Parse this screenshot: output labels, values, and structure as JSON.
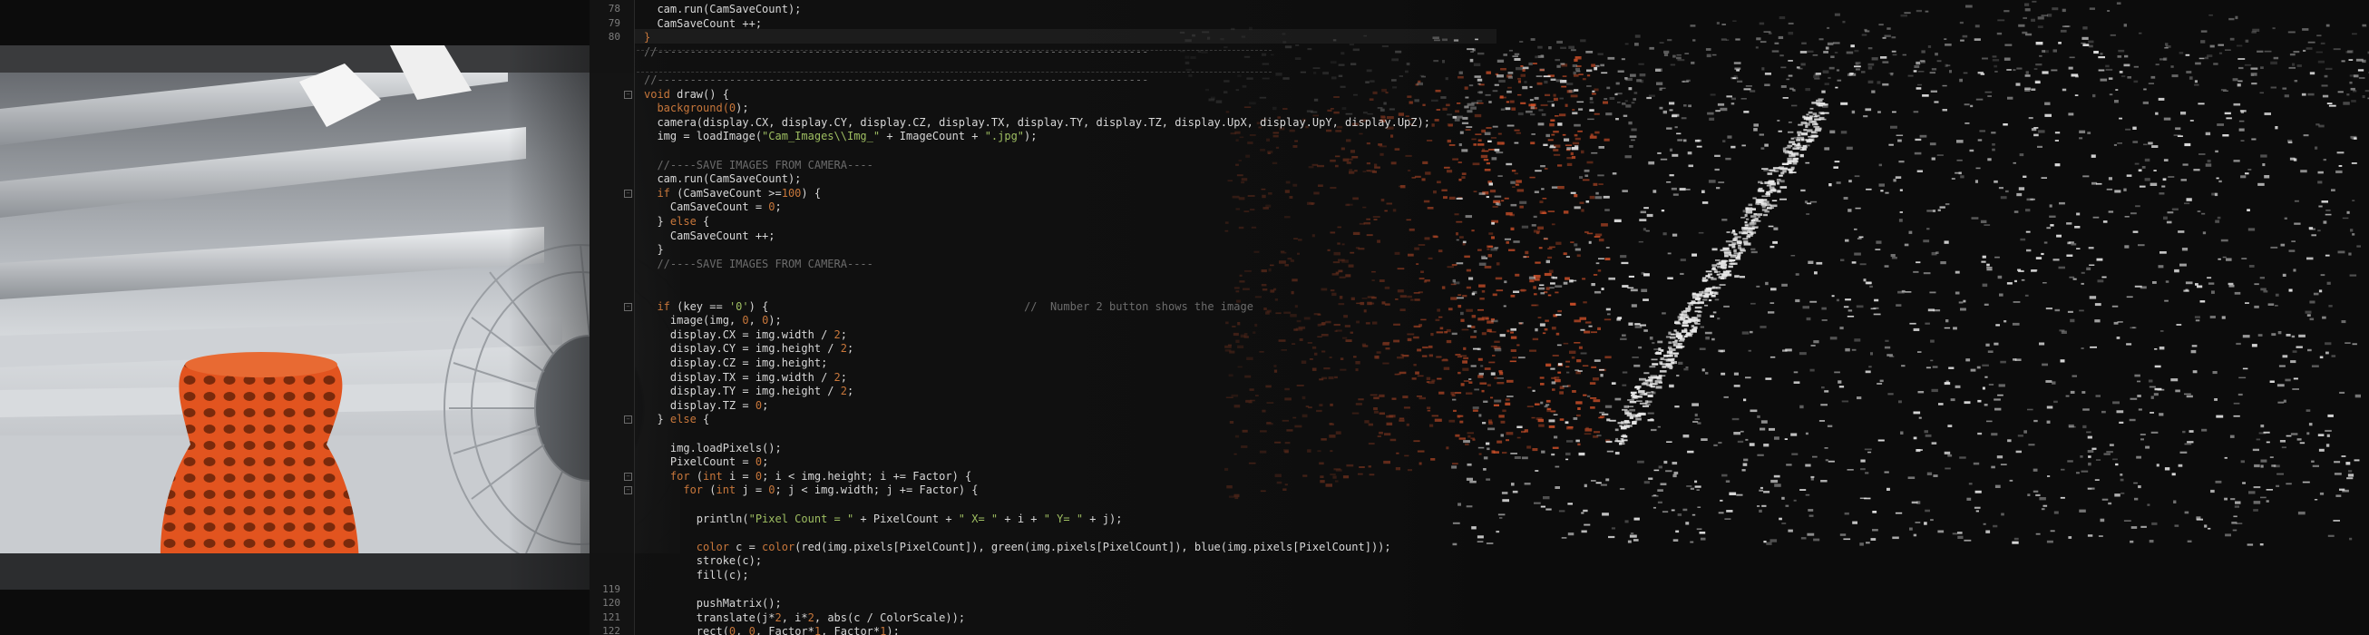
{
  "editor": {
    "lines": [
      {
        "n": "78",
        "segments": [
          {
            "t": "  cam.run(CamSaveCount);",
            "c": "plain"
          }
        ]
      },
      {
        "n": "79",
        "segments": [
          {
            "t": "  CamSaveCount ++;",
            "c": "plain"
          }
        ]
      },
      {
        "n": "80",
        "segments": [
          {
            "t": "}",
            "c": "kw"
          }
        ]
      },
      {
        "n": "",
        "segments": [
          {
            "t": "//---------------------------------------------------------------------------",
            "c": "cmt"
          }
        ]
      },
      {
        "n": "",
        "segments": [
          {
            "t": "",
            "c": "plain"
          }
        ]
      },
      {
        "n": "",
        "segments": [
          {
            "t": "//---------------------------------------------------------------------------",
            "c": "cmt"
          }
        ]
      },
      {
        "n": "",
        "segments": [
          {
            "t": "void",
            "c": "kw"
          },
          {
            "t": " draw() {",
            "c": "plain"
          }
        ]
      },
      {
        "n": "",
        "segments": [
          {
            "t": "  background(",
            "c": "kw"
          },
          {
            "t": "0",
            "c": "num"
          },
          {
            "t": ");",
            "c": "plain"
          }
        ]
      },
      {
        "n": "",
        "segments": [
          {
            "t": "  camera(display.CX, display.CY, display.CZ, display.TX, display.TY, display.TZ, display.UpX, display.UpY, display.UpZ);",
            "c": "plain"
          }
        ]
      },
      {
        "n": "",
        "segments": [
          {
            "t": "  img = loadImage(",
            "c": "plain"
          },
          {
            "t": "\"Cam_Images\\\\Img_\"",
            "c": "str"
          },
          {
            "t": " + ImageCount + ",
            "c": "plain"
          },
          {
            "t": "\".jpg\"",
            "c": "str"
          },
          {
            "t": ");",
            "c": "plain"
          }
        ]
      },
      {
        "n": "",
        "segments": [
          {
            "t": "",
            "c": "plain"
          }
        ]
      },
      {
        "n": "",
        "segments": [
          {
            "t": "  //----SAVE IMAGES FROM CAMERA----",
            "c": "cmt"
          }
        ]
      },
      {
        "n": "",
        "segments": [
          {
            "t": "  cam.run(CamSaveCount);",
            "c": "plain"
          }
        ]
      },
      {
        "n": "",
        "segments": [
          {
            "t": "  if",
            "c": "kw"
          },
          {
            "t": " (CamSaveCount >=",
            "c": "plain"
          },
          {
            "t": "100",
            "c": "num"
          },
          {
            "t": ") {",
            "c": "plain"
          }
        ]
      },
      {
        "n": "",
        "segments": [
          {
            "t": "    CamSaveCount = ",
            "c": "plain"
          },
          {
            "t": "0",
            "c": "num"
          },
          {
            "t": ";",
            "c": "plain"
          }
        ]
      },
      {
        "n": "",
        "segments": [
          {
            "t": "  } ",
            "c": "plain"
          },
          {
            "t": "else",
            "c": "kw"
          },
          {
            "t": " {",
            "c": "plain"
          }
        ]
      },
      {
        "n": "",
        "segments": [
          {
            "t": "    CamSaveCount ++;",
            "c": "plain"
          }
        ]
      },
      {
        "n": "",
        "segments": [
          {
            "t": "  }",
            "c": "plain"
          }
        ]
      },
      {
        "n": "",
        "segments": [
          {
            "t": "  //----SAVE IMAGES FROM CAMERA----",
            "c": "cmt"
          }
        ]
      },
      {
        "n": "",
        "segments": [
          {
            "t": "",
            "c": "plain"
          }
        ]
      },
      {
        "n": "",
        "segments": [
          {
            "t": "",
            "c": "plain"
          }
        ]
      },
      {
        "n": "",
        "segments": [
          {
            "t": "  if",
            "c": "kw"
          },
          {
            "t": " (key == ",
            "c": "plain"
          },
          {
            "t": "'0'",
            "c": "str"
          },
          {
            "t": ") {                                       ",
            "c": "plain"
          },
          {
            "t": "//  Number 2 button shows the image",
            "c": "cmt"
          }
        ]
      },
      {
        "n": "",
        "segments": [
          {
            "t": "    image(img, ",
            "c": "plain"
          },
          {
            "t": "0",
            "c": "num"
          },
          {
            "t": ", ",
            "c": "plain"
          },
          {
            "t": "0",
            "c": "num"
          },
          {
            "t": ");",
            "c": "plain"
          }
        ]
      },
      {
        "n": "",
        "segments": [
          {
            "t": "    display.CX = img.width / ",
            "c": "plain"
          },
          {
            "t": "2",
            "c": "num"
          },
          {
            "t": ";",
            "c": "plain"
          }
        ]
      },
      {
        "n": "",
        "segments": [
          {
            "t": "    display.CY = img.height / ",
            "c": "plain"
          },
          {
            "t": "2",
            "c": "num"
          },
          {
            "t": ";",
            "c": "plain"
          }
        ]
      },
      {
        "n": "",
        "segments": [
          {
            "t": "    display.CZ = img.height;",
            "c": "plain"
          }
        ]
      },
      {
        "n": "",
        "segments": [
          {
            "t": "    display.TX = img.width / ",
            "c": "plain"
          },
          {
            "t": "2",
            "c": "num"
          },
          {
            "t": ";",
            "c": "plain"
          }
        ]
      },
      {
        "n": "",
        "segments": [
          {
            "t": "    display.TY = img.height / ",
            "c": "plain"
          },
          {
            "t": "2",
            "c": "num"
          },
          {
            "t": ";",
            "c": "plain"
          }
        ]
      },
      {
        "n": "",
        "segments": [
          {
            "t": "    display.TZ = ",
            "c": "plain"
          },
          {
            "t": "0",
            "c": "num"
          },
          {
            "t": ";",
            "c": "plain"
          }
        ]
      },
      {
        "n": "",
        "segments": [
          {
            "t": "  } ",
            "c": "plain"
          },
          {
            "t": "else",
            "c": "kw"
          },
          {
            "t": " {",
            "c": "plain"
          }
        ]
      },
      {
        "n": "",
        "segments": [
          {
            "t": "",
            "c": "plain"
          }
        ]
      },
      {
        "n": "",
        "segments": [
          {
            "t": "    img.loadPixels();",
            "c": "plain"
          }
        ]
      },
      {
        "n": "",
        "segments": [
          {
            "t": "    PixelCount = ",
            "c": "plain"
          },
          {
            "t": "0",
            "c": "num"
          },
          {
            "t": ";",
            "c": "plain"
          }
        ]
      },
      {
        "n": "",
        "segments": [
          {
            "t": "    for",
            "c": "kw"
          },
          {
            "t": " (",
            "c": "plain"
          },
          {
            "t": "int",
            "c": "kw"
          },
          {
            "t": " i = ",
            "c": "plain"
          },
          {
            "t": "0",
            "c": "num"
          },
          {
            "t": "; i < img.height; i += Factor) {",
            "c": "plain"
          }
        ]
      },
      {
        "n": "",
        "segments": [
          {
            "t": "      for",
            "c": "kw"
          },
          {
            "t": " (",
            "c": "plain"
          },
          {
            "t": "int",
            "c": "kw"
          },
          {
            "t": " j = ",
            "c": "plain"
          },
          {
            "t": "0",
            "c": "num"
          },
          {
            "t": "; j < img.width; j += Factor) {",
            "c": "plain"
          }
        ]
      },
      {
        "n": "",
        "segments": [
          {
            "t": "",
            "c": "plain"
          }
        ]
      },
      {
        "n": "",
        "segments": [
          {
            "t": "        println(",
            "c": "plain"
          },
          {
            "t": "\"Pixel Count = \"",
            "c": "str"
          },
          {
            "t": " + PixelCount + ",
            "c": "plain"
          },
          {
            "t": "\" X= \"",
            "c": "str"
          },
          {
            "t": " + i + ",
            "c": "plain"
          },
          {
            "t": "\" Y= \"",
            "c": "str"
          },
          {
            "t": " + j);",
            "c": "plain"
          }
        ]
      },
      {
        "n": "",
        "segments": [
          {
            "t": "",
            "c": "plain"
          }
        ]
      },
      {
        "n": "",
        "segments": [
          {
            "t": "        color",
            "c": "kw"
          },
          {
            "t": " c = ",
            "c": "plain"
          },
          {
            "t": "color",
            "c": "kw"
          },
          {
            "t": "(red(img.pixels[PixelCount]), green(img.pixels[PixelCount]), blue(img.pixels[PixelCount]));",
            "c": "plain"
          }
        ]
      },
      {
        "n": "",
        "segments": [
          {
            "t": "        stroke(c);",
            "c": "plain"
          }
        ]
      },
      {
        "n": "",
        "segments": [
          {
            "t": "        fill(c);",
            "c": "plain"
          }
        ]
      },
      {
        "n": "119",
        "segments": [
          {
            "t": "",
            "c": "plain"
          }
        ]
      },
      {
        "n": "120",
        "segments": [
          {
            "t": "        pushMatrix();",
            "c": "plain"
          }
        ]
      },
      {
        "n": "121",
        "segments": [
          {
            "t": "        translate(j*",
            "c": "plain"
          },
          {
            "t": "2",
            "c": "num"
          },
          {
            "t": ", i*",
            "c": "plain"
          },
          {
            "t": "2",
            "c": "num"
          },
          {
            "t": ", abs(c / ColorScale));",
            "c": "plain"
          }
        ]
      },
      {
        "n": "122",
        "segments": [
          {
            "t": "        rect(",
            "c": "plain"
          },
          {
            "t": "0",
            "c": "num"
          },
          {
            "t": ", ",
            "c": "plain"
          },
          {
            "t": "0",
            "c": "num"
          },
          {
            "t": ", Factor*",
            "c": "plain"
          },
          {
            "t": "1",
            "c": "num"
          },
          {
            "t": ", Factor*",
            "c": "plain"
          },
          {
            "t": "1",
            "c": "num"
          },
          {
            "t": ");",
            "c": "plain"
          }
        ]
      }
    ]
  },
  "colors": {
    "keyword": "#c8773b",
    "string": "#9fbf62",
    "comment": "#6c6c6c",
    "text": "#d8d8d8",
    "vase": "#e2541f",
    "cloud_white": "#e8e8e8",
    "cloud_orange": "#d4522a"
  },
  "photo": {
    "objects": [
      "orange-lattice-vase",
      "wire-fan",
      "metal-shelves"
    ]
  }
}
